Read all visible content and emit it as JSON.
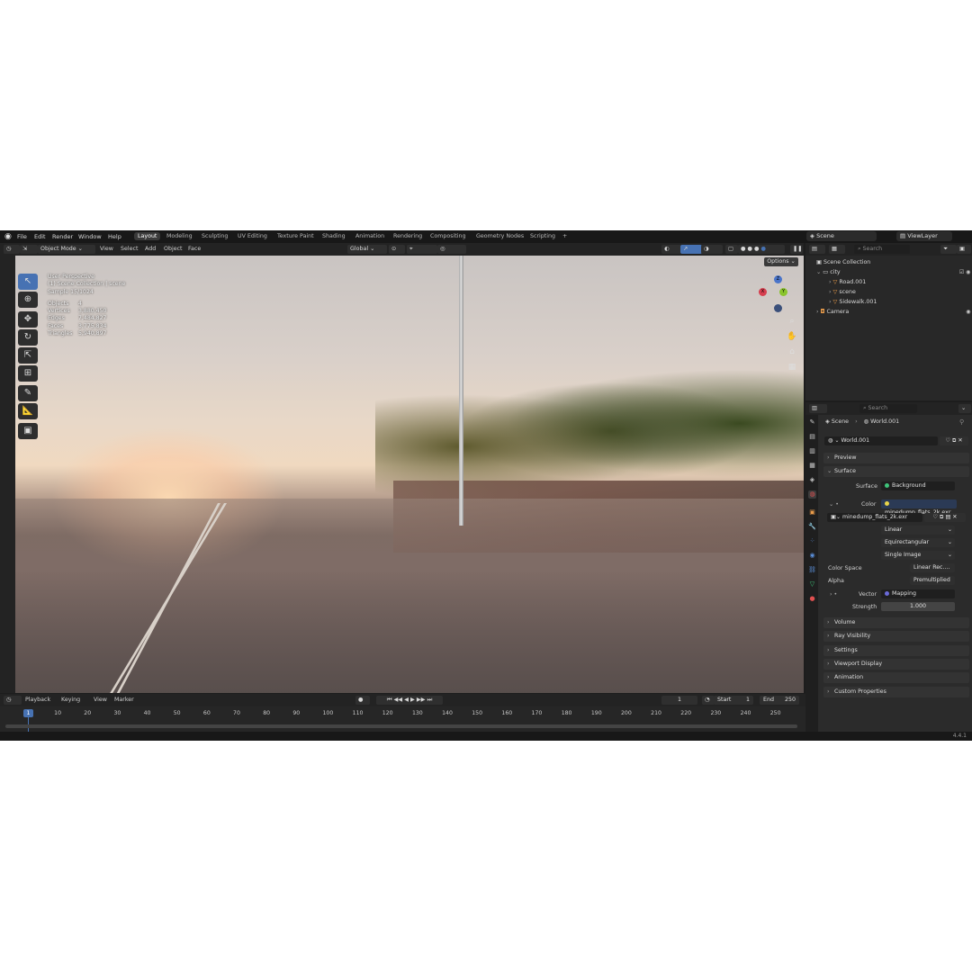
{
  "menu": {
    "items": [
      "File",
      "Edit",
      "Render",
      "Window",
      "Help"
    ]
  },
  "workspaces": [
    "Layout",
    "Modeling",
    "Sculpting",
    "UV Editing",
    "Texture Paint",
    "Shading",
    "Animation",
    "Rendering",
    "Compositing",
    "Geometry Nodes",
    "Scripting"
  ],
  "add_workspace": "+",
  "top_right": {
    "scene": "Scene",
    "view_layer": "ViewLayer"
  },
  "viewport_header": {
    "mode": "Object Mode",
    "menus": [
      "View",
      "Select",
      "Add",
      "Object",
      "Face"
    ],
    "orientation": "Global",
    "options": "Options"
  },
  "overlay_info": {
    "view": "User Perspective",
    "collection": "(1) Scene Collection | scene",
    "sample": "Sample 15/1024",
    "stats": [
      {
        "key": "Objects",
        "value": "4"
      },
      {
        "key": "Vertices",
        "value": "3,880,450"
      },
      {
        "key": "Edges",
        "value": "7,484,827"
      },
      {
        "key": "Faces",
        "value": "3,775,834"
      },
      {
        "key": "Triangles",
        "value": "5,940,897"
      }
    ]
  },
  "gizmo": {
    "x": "X",
    "y": "Y",
    "z": "Z"
  },
  "timeline": {
    "menus": [
      "Playback",
      "Keying",
      "View",
      "Marker"
    ],
    "current_frame": "1",
    "start_label": "Start",
    "start": "1",
    "end_label": "End",
    "end": "250",
    "ruler_current": "1",
    "ticks": [
      "10",
      "20",
      "30",
      "40",
      "50",
      "60",
      "70",
      "80",
      "90",
      "100",
      "110",
      "120",
      "130",
      "140",
      "150",
      "160",
      "170",
      "180",
      "190",
      "200",
      "210",
      "220",
      "230",
      "240",
      "250"
    ]
  },
  "outliner": {
    "search_placeholder": "Search",
    "root": "Scene Collection",
    "items": [
      {
        "name": "city",
        "depth": 0
      },
      {
        "name": "Road.001",
        "depth": 1
      },
      {
        "name": "scene",
        "depth": 1
      },
      {
        "name": "Sidewalk.001",
        "depth": 1
      },
      {
        "name": "Camera",
        "depth": 0
      }
    ]
  },
  "properties": {
    "search_placeholder": "Search",
    "breadcrumb_scene": "Scene",
    "breadcrumb_world": "World.001",
    "world_name": "World.001",
    "sections": {
      "preview": "Preview",
      "surface": "Surface",
      "volume": "Volume",
      "ray_visibility": "Ray Visibility",
      "settings": "Settings",
      "viewport_display": "Viewport Display",
      "animation": "Animation",
      "custom_properties": "Custom Properties"
    },
    "surface_label": "Surface",
    "surface_value": "Background",
    "color_label": "Color",
    "color_value": "minedump_flats_2k.exr",
    "image_name": "minedump_flats_2k.exr",
    "interpolation": "Linear",
    "projection": "Equirectangular",
    "source": "Single Image",
    "color_space_label": "Color Space",
    "color_space": "Linear Rec....",
    "alpha_label": "Alpha",
    "alpha": "Premultiplied",
    "vector_label": "Vector",
    "vector_value": "Mapping",
    "strength_label": "Strength",
    "strength_value": "1.000"
  },
  "version": "4.4.1",
  "colors": {
    "accent": "#4772b3",
    "bg": "#1d1d1d",
    "panel": "#2b2b2b"
  }
}
